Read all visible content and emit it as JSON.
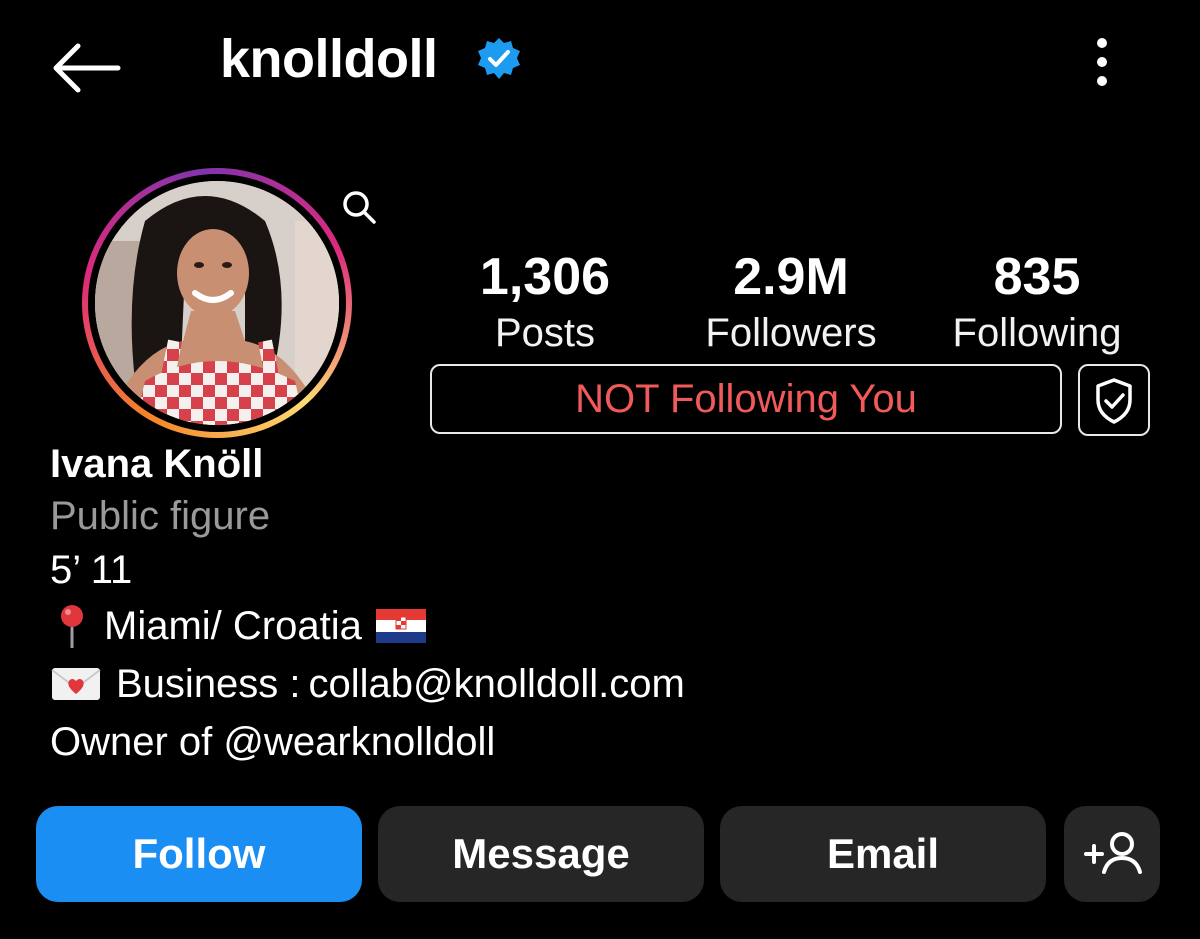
{
  "header": {
    "username": "knolldoll",
    "verified_color": "#1d9bf0"
  },
  "profile": {
    "stats": [
      {
        "value": "1,306",
        "label": "Posts"
      },
      {
        "value": "2.9M",
        "label": "Followers"
      },
      {
        "value": "835",
        "label": "Following"
      }
    ],
    "follow_status": "NOT Following You",
    "follow_status_color": "#f05a5a",
    "avatar_ring_colors": [
      "#f58529",
      "#dd2a7b",
      "#8134af"
    ]
  },
  "bio": {
    "full_name": "Ivana Knöll",
    "category": "Public figure",
    "height": "5’ 11",
    "location": "Miami/ Croatia",
    "business_label": "Business : ",
    "business_email": "collab@knolldoll.com",
    "owner_prefix": "Owner of ",
    "owner_handle": "@wearknolldoll"
  },
  "actions": {
    "follow": "Follow",
    "message": "Message",
    "email": "Email",
    "follow_color": "#1a8ef2"
  },
  "icons": {
    "back": "arrow-left-icon",
    "verified": "verified-badge-icon",
    "menu": "more-vertical-icon",
    "zoom": "search-icon",
    "shield": "shield-check-icon",
    "pin": "round-pushpin-emoji",
    "flag": "croatia-flag-emoji",
    "mail": "love-letter-emoji",
    "add_person": "add-person-icon"
  }
}
